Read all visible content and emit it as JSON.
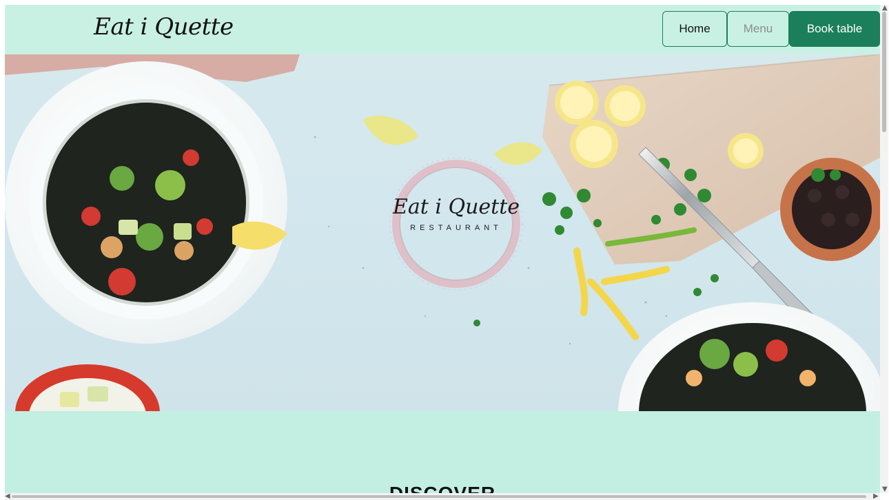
{
  "header": {
    "brand": "Eat i Quette",
    "nav": {
      "home": "Home",
      "menu": "Menu",
      "book_table": "Book table"
    }
  },
  "hero": {
    "logo_script": "Eat i Quette",
    "logo_subtitle": "RESTAURANT"
  },
  "section": {
    "heading": "DISCOVER"
  },
  "colors": {
    "header_bg": "#c9f1e3",
    "primary": "#1b7f5b",
    "section_bg": "#c3efe2"
  },
  "icons": {
    "scroll_up": "scroll-up-arrow-icon",
    "scroll_down": "scroll-down-arrow-icon",
    "scroll_left": "scroll-left-arrow-icon",
    "scroll_right": "scroll-right-arrow-icon"
  }
}
